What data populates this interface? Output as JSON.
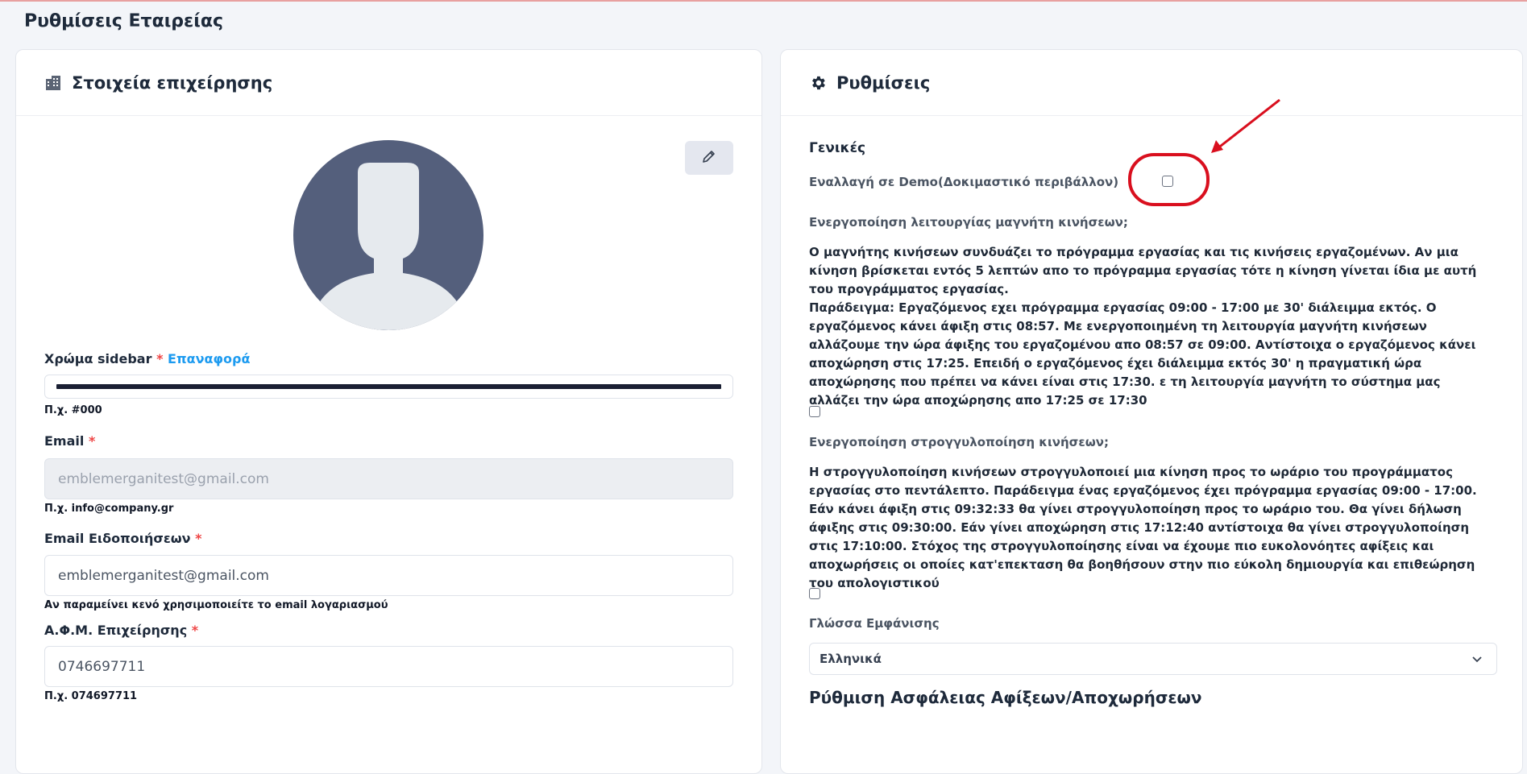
{
  "page": {
    "title": "Ρυθμίσεις Εταιρείας"
  },
  "left_card": {
    "title": "Στοιχεία επιχείρησης",
    "icon": "building-icon",
    "edit_icon": "pencil-icon",
    "sidebar_color": {
      "label": "Χρώμα sidebar",
      "required": "*",
      "reset_label": "Επαναφορά",
      "value_color": "#1a1f33",
      "hint": "Π.χ. #000"
    },
    "email": {
      "label": "Email",
      "required": "*",
      "value": "emblemerganitest@gmail.com",
      "hint": "Π.χ. info@company.gr"
    },
    "notification_email": {
      "label": "Email Ειδοποιήσεων",
      "required": "*",
      "value": "emblemerganitest@gmail.com",
      "hint": "Αν παραμείνει κενό χρησιμοποιείτε το email λογαριασμού"
    },
    "vat": {
      "label": "Α.Φ.Μ. Επιχείρησης",
      "required": "*",
      "value": "0746697711",
      "hint": "Π.χ. 074697711"
    }
  },
  "right_card": {
    "title": "Ρυθμίσεις",
    "icon": "gear-icon",
    "general_title": "Γενικές",
    "demo_toggle_label": "Εναλλαγή σε Demo(Δοκιμαστικό περιβάλλον)",
    "demo_checked": false,
    "magnet": {
      "label": "Ενεργοποίηση λειτουργίας μαγνήτη κινήσεων;",
      "description": "Ο μαγνήτης κινήσεων συνδυάζει το πρόγραμμα εργασίας και τις κινήσεις εργαζομένων. Αν μια κίνηση βρίσκεται εντός 5 λεπτών απο το πρόγραμμα εργασίας τότε η κίνηση γίνεται ίδια με αυτή του προγράμματος εργασίας.",
      "example": "Παράδειγμα: Εργαζόμενος εχει πρόγραμμα εργασίας 09:00 - 17:00 με 30' διάλειμμα εκτός. Ο εργαζόμενος κάνει άφιξη στις 08:57. Με ενεργοποιημένη τη λειτουργία μαγνήτη κινήσεων αλλάζουμε την ώρα άφιξης του εργαζομένου απο 08:57 σε 09:00. Αντίστοιχα ο εργαζόμενος κάνει αποχώρηση στις 17:25. Επειδή ο εργαζόμενος έχει διάλειμμα εκτός 30' η πραγματική ώρα αποχώρησης που πρέπει να κάνει είναι στις 17:30. ε τη λειτουργία μαγνήτη το σύστημα μας αλλάζει την ώρα αποχώρησης απο 17:25 σε 17:30",
      "checked": false
    },
    "rounding": {
      "label": "Ενεργοποίηση στρογγυλοποίηση κινήσεων;",
      "description": "Η στρογγυλοποίηση κινήσεων στρογγυλοποιεί μια κίνηση προς το ωράριο του προγράμματος εργασίας στο πεντάλεπτο. Παράδειγμα ένας εργαζόμενος έχει πρόγραμμα εργασίας 09:00 - 17:00. Εάν κάνει άφιξη στις 09:32:33 θα γίνει στρογγυλοποίηση προς το ωράριο του. Θα γίνει δήλωση άφιξης στις 09:30:00. Εάν γίνει αποχώρηση στις 17:12:40 αντίστοιχα θα γίνει στρογγυλοποίηση στις 17:10:00. Στόχος της στρογγυλοποίησης είναι να έχουμε πιο ευκολονόητες αφίξεις και αποχωρήσεις οι οποίες κατ'επεκταση θα βοηθήσουν στην πιο εύκολη δημιουργία και επιθεώρηση του απολογιστικού",
      "checked": false
    },
    "language": {
      "label": "Γλώσσα Εμφάνισης",
      "selected": "Ελληνικά"
    },
    "security_heading": "Ρύθμιση Ασφάλειας Αφίξεων/Αποχωρήσεων"
  },
  "annotation": {
    "color": "#d90f1e"
  }
}
